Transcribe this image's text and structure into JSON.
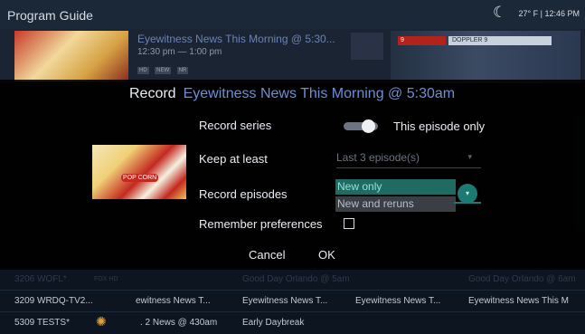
{
  "guide": {
    "title": "Program Guide",
    "weather": "27° F  |  12:46 PM",
    "hero": {
      "title": "Eyewitness News This Morning @ 5:30...",
      "time": "12:30 pm — 1:00 pm",
      "badges": [
        "HD",
        "NEW",
        "NR"
      ]
    },
    "news_banner": "DOPPLER 9",
    "news_channel": "9",
    "rows": [
      {
        "channel": "3206 WOFL*",
        "logo": "FOX HD",
        "programs": [
          "Good Day Orlando @ 5am",
          "Good Day Orlando @ 6am"
        ]
      },
      {
        "channel": "3209 WRDQ-TV2...",
        "programs": [
          "ewitness News T...",
          "Eyewitness News T...",
          "Eyewitness News T...",
          "Eyewitness News This M"
        ]
      },
      {
        "channel": "5309 TESTS*",
        "programs": [
          ". 2 News @ 430am",
          "Early Daybreak"
        ]
      }
    ]
  },
  "dialog": {
    "title": "Record",
    "program": "Eyewitness News This Morning @ 5:30am",
    "popcorn_label": "POP CORN",
    "record_series": {
      "label": "Record series",
      "value": "This episode only",
      "on": false
    },
    "keep_at_least": {
      "label": "Keep at least",
      "value": "Last 3 episode(s)"
    },
    "record_episodes": {
      "label": "Record episodes",
      "options": [
        "New only",
        "New and reruns"
      ],
      "selected": "New only"
    },
    "remember": {
      "label": "Remember preferences",
      "checked": false
    },
    "cancel": "Cancel",
    "ok": "OK"
  },
  "colors": {
    "accent": "#6c8fd6",
    "selection": "#1f6b62",
    "background": "#0a0d14"
  },
  "icons": {
    "moon": "moon-icon",
    "check": "checkbox-icon"
  }
}
